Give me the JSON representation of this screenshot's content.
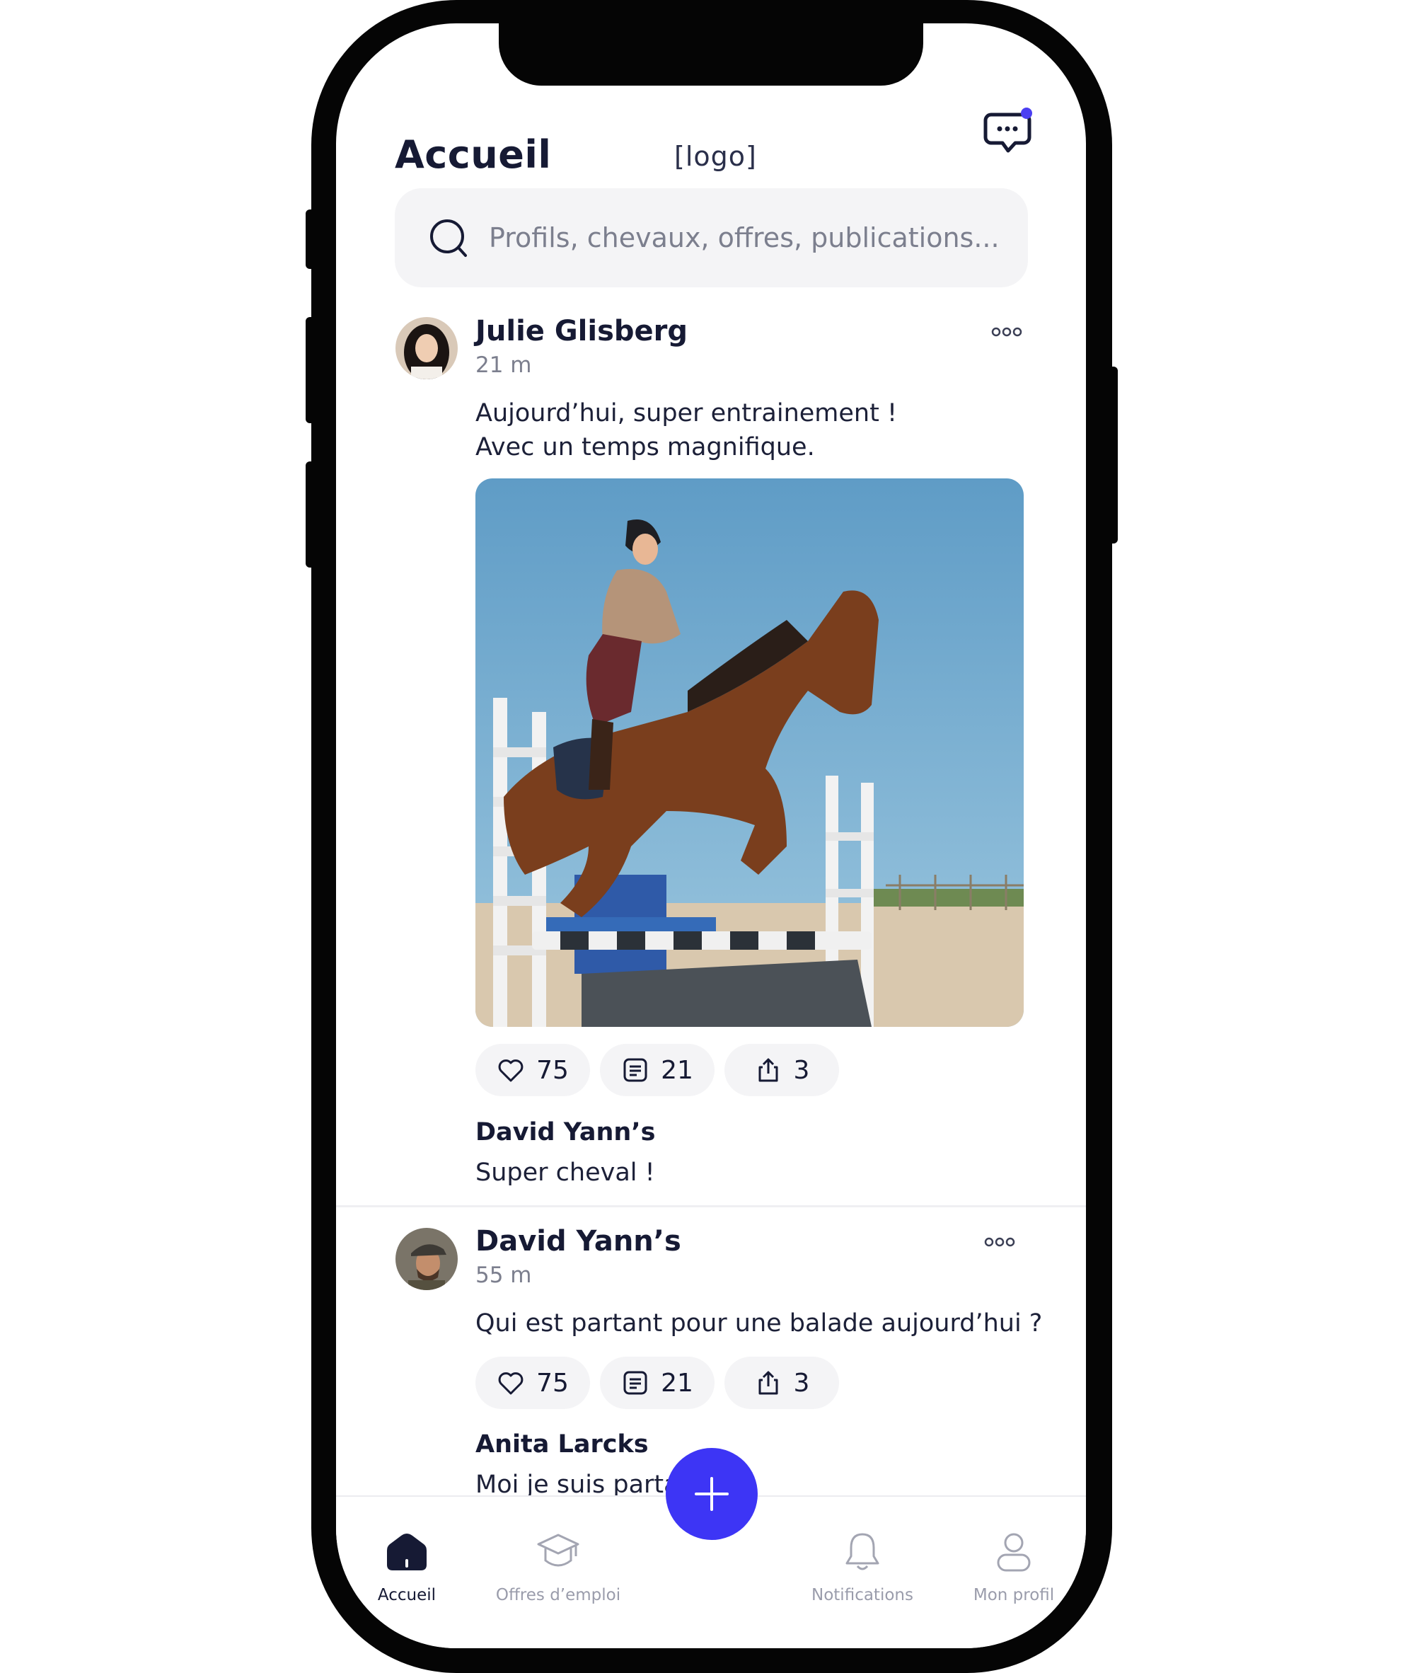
{
  "header": {
    "title": "Accueil",
    "logo_placeholder": "[logo]",
    "chat_icon": "chat-bubble-icon",
    "notification_dot_color": "#4b3ff2"
  },
  "search": {
    "placeholder": "Profils, chevaux, offres, publications..."
  },
  "posts": [
    {
      "author": "Julie Glisberg",
      "time": "21 m",
      "text_lines": [
        "Aujourd’hui, super entrainement !",
        "Avec un temps magnifique."
      ],
      "has_photo": true,
      "likes": "75",
      "comments": "21",
      "shares": "3",
      "top_comment": {
        "author": "David Yann’s",
        "text": "Super cheval !"
      }
    },
    {
      "author": "David Yann’s",
      "time": "55 m",
      "text_lines": [
        "Qui est partant pour une balade aujourd’hui ?"
      ],
      "has_photo": false,
      "likes": "75",
      "comments": "21",
      "shares": "3",
      "top_comment": {
        "author": "Anita Larcks",
        "text": "Moi je suis partante"
      }
    }
  ],
  "nav": {
    "items": [
      {
        "label": "Accueil",
        "icon": "home-icon",
        "active": true
      },
      {
        "label": "Offres d’emploi",
        "icon": "graduation-cap-icon",
        "active": false
      },
      {
        "label": "Notifications",
        "icon": "bell-icon",
        "active": false
      },
      {
        "label": "Mon profil",
        "icon": "user-icon",
        "active": false
      }
    ]
  },
  "fab": {
    "icon": "plus-icon",
    "color": "#3d35f5"
  },
  "colors": {
    "accent": "#3d35f5",
    "text_dark": "#161a34",
    "text_muted": "#7c7f8e",
    "surface": "#f4f4f6"
  }
}
